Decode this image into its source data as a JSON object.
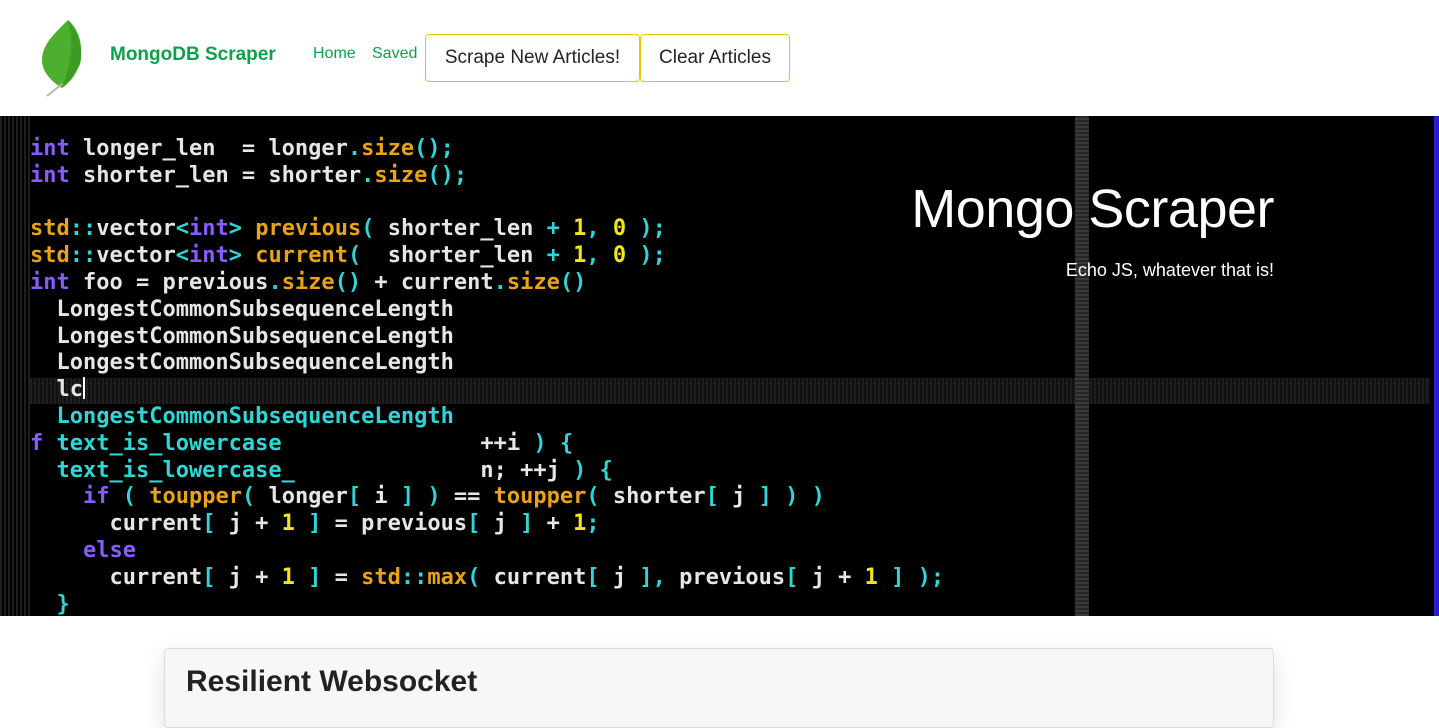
{
  "navbar": {
    "logo_icon": "mongodb-leaf-icon",
    "brand": "MongoDB Scraper",
    "links": {
      "home": "Home",
      "saved": "Saved"
    },
    "buttons": {
      "scrape": "Scrape New Articles!",
      "clear": "Clear Articles"
    },
    "colors": {
      "brand": "#0ca04b",
      "button_border": "#e3c800"
    }
  },
  "hero": {
    "title": "Mongo Scraper",
    "subtitle": "Echo JS, whatever that is!",
    "background": "code-screenshot-image",
    "code_lines": [
      "int longer_len  = longer.size();",
      "int shorter_len = shorter.size();",
      "",
      "std::vector<int> previous( shorter_len + 1, 0 );",
      "std::vector<int> current(  shorter_len + 1, 0 );",
      "int foo = previous.size() + current.size()",
      "LongestCommonSubsequenceLength",
      "LongestCommonSubsequenceLength",
      "LongestCommonSubsequenceLength",
      "lc",
      "LongestCommonSubsequenceLength",
      "f text_is_lowercase               ++i ) {",
      "text_is_lowercase_               n; ++j ) {",
      "if ( toupper( longer[ i ] ) == toupper( shorter[ j ] ) )",
      "current[ j + 1 ] = previous[ j ] + 1;",
      "else",
      "current[ j + 1 ] = std::max( current[ j ], previous[ j + 1 ] );",
      "}"
    ]
  },
  "articles": [
    {
      "title": "Resilient Websocket"
    }
  ]
}
